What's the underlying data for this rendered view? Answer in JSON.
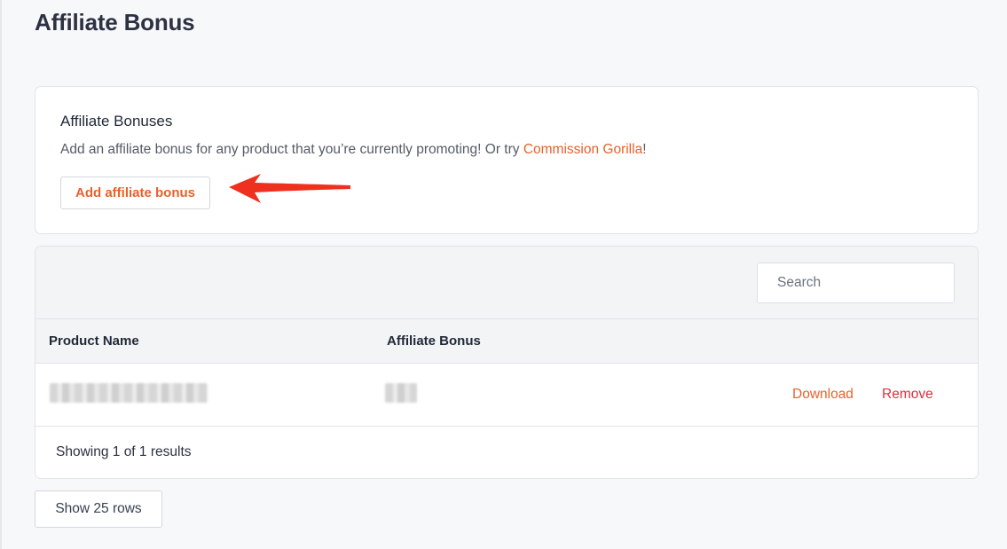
{
  "page": {
    "title": "Affiliate Bonus"
  },
  "bonus_card": {
    "heading": "Affiliate Bonuses",
    "description_prefix": "Add an affiliate bonus for any product that you’re currently promoting! Or try ",
    "description_link": "Commission Gorilla",
    "description_suffix": "!",
    "add_button_label": "Add affiliate bonus"
  },
  "table": {
    "search_placeholder": "Search",
    "columns": [
      "Product Name",
      "Affiliate Bonus"
    ],
    "rows": [
      {
        "download_label": "Download",
        "remove_label": "Remove"
      }
    ],
    "footer_text": "Showing 1 of 1 results"
  },
  "pagination": {
    "rows_button_label": "Show 25 rows"
  },
  "colors": {
    "accent": "#e8622a",
    "danger": "#dc2e3c",
    "annotation_arrow": "#f0301e"
  },
  "icons": {
    "annotation": "left-arrow-icon"
  }
}
